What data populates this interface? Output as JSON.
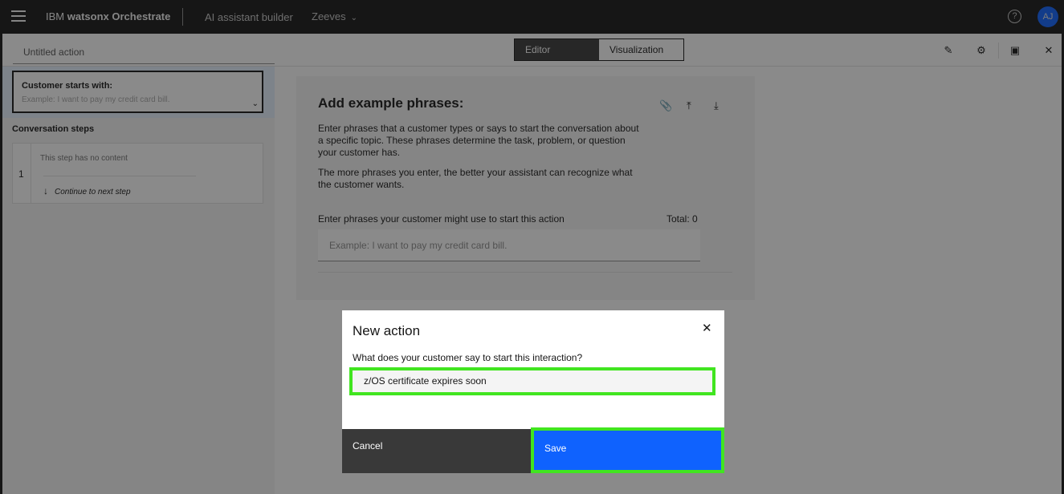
{
  "header": {
    "brand_prefix": "IBM",
    "brand_name": "watsonx Orchestrate",
    "section": "AI assistant builder",
    "assistant_name": "Zeeves",
    "avatar_initials": "AJ"
  },
  "editor": {
    "action_title_placeholder": "Untitled action",
    "tabs": [
      "Editor",
      "Visualization"
    ],
    "active_tab": "Editor"
  },
  "left": {
    "starts_title": "Customer starts with:",
    "starts_placeholder": "Example: I want to pay my credit card bill.",
    "conversation_steps_label": "Conversation steps",
    "step": {
      "number": "1",
      "empty_text": "This step has no content",
      "next_text": "Continue to next step"
    }
  },
  "phrases": {
    "title": "Add example phrases:",
    "para1": "Enter phrases that a customer types or says to start the conversation about a specific topic. These phrases determine the task, problem, or question your customer has.",
    "para2": "The more phrases you enter, the better your assistant can recognize what the customer wants.",
    "input_label": "Enter phrases your customer might use to start this action",
    "total": "Total: 0",
    "input_placeholder": "Example: I want to pay my credit card bill."
  },
  "modal": {
    "title": "New action",
    "question": "What does your customer say to start this interaction?",
    "input_value": "z/OS certificate expires soon",
    "cancel_label": "Cancel",
    "save_label": "Save"
  },
  "colors": {
    "header_bg": "#161616",
    "primary": "#0f62fe",
    "highlight": "#41e520",
    "secondary_button": "#393939"
  },
  "icons": [
    "menu-icon",
    "help-icon",
    "chevron-down-icon",
    "edit-icon",
    "settings-icon",
    "save-icon",
    "close-icon",
    "attachment-icon",
    "upload-icon",
    "download-icon",
    "arrow-down-icon"
  ]
}
